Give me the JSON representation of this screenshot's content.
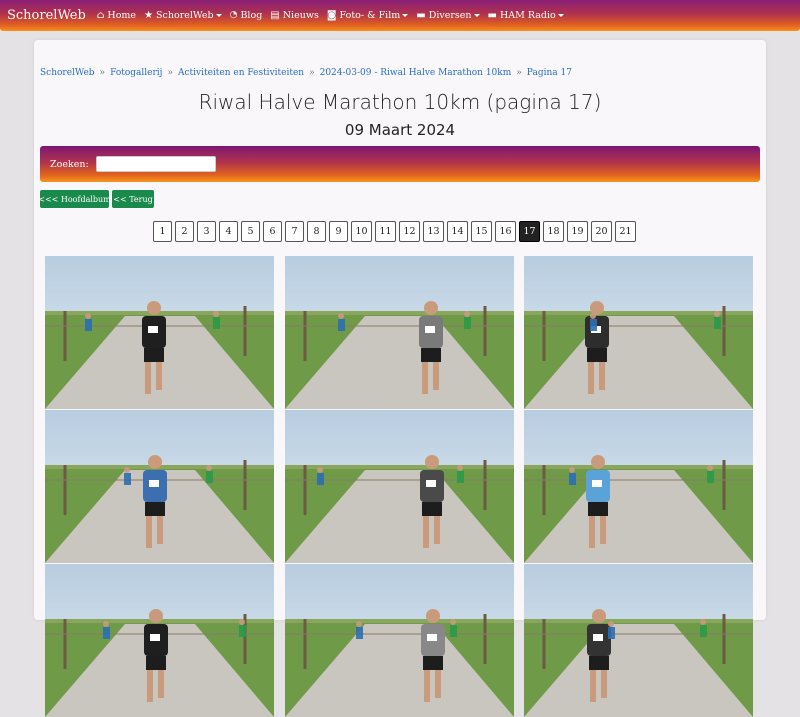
{
  "navbar": {
    "brand": "SchorelWeb",
    "items": [
      {
        "label": "Home",
        "icon": "home-icon",
        "dropdown": false
      },
      {
        "label": "SchorelWeb",
        "icon": "star-icon",
        "dropdown": true
      },
      {
        "label": "Blog",
        "icon": "rss-icon",
        "dropdown": false
      },
      {
        "label": "Nieuws",
        "icon": "newspaper-icon",
        "dropdown": false
      },
      {
        "label": "Foto- & Film",
        "icon": "camera-icon",
        "dropdown": true
      },
      {
        "label": "Diversen",
        "icon": "folder-icon",
        "dropdown": true
      },
      {
        "label": "HAM Radio",
        "icon": "folder-icon",
        "dropdown": true
      }
    ]
  },
  "breadcrumb": [
    "SchorelWeb",
    "Fotogallerij",
    "Activiteiten en Festiviteiten",
    "2024-03-09 - Riwal Halve Marathon 10km",
    "Pagina 17"
  ],
  "page": {
    "title": "Riwal Halve Marathon 10km (pagina 17)",
    "subtitle": "09 Maart 2024"
  },
  "search": {
    "label": "Zoeken:",
    "value": ""
  },
  "buttons": {
    "main_album": "<<< Hoofdalbum",
    "back": "<< Terug"
  },
  "pagination": {
    "pages": [
      "1",
      "2",
      "3",
      "4",
      "5",
      "6",
      "7",
      "8",
      "9",
      "10",
      "11",
      "12",
      "13",
      "14",
      "15",
      "16",
      "17",
      "18",
      "19",
      "20",
      "21"
    ],
    "active": "17"
  },
  "colors": {
    "gradient_top": "#8a1f78",
    "gradient_bottom": "#f7901c",
    "button_green": "#1a8a4c",
    "link_blue": "#2a6dc4"
  }
}
